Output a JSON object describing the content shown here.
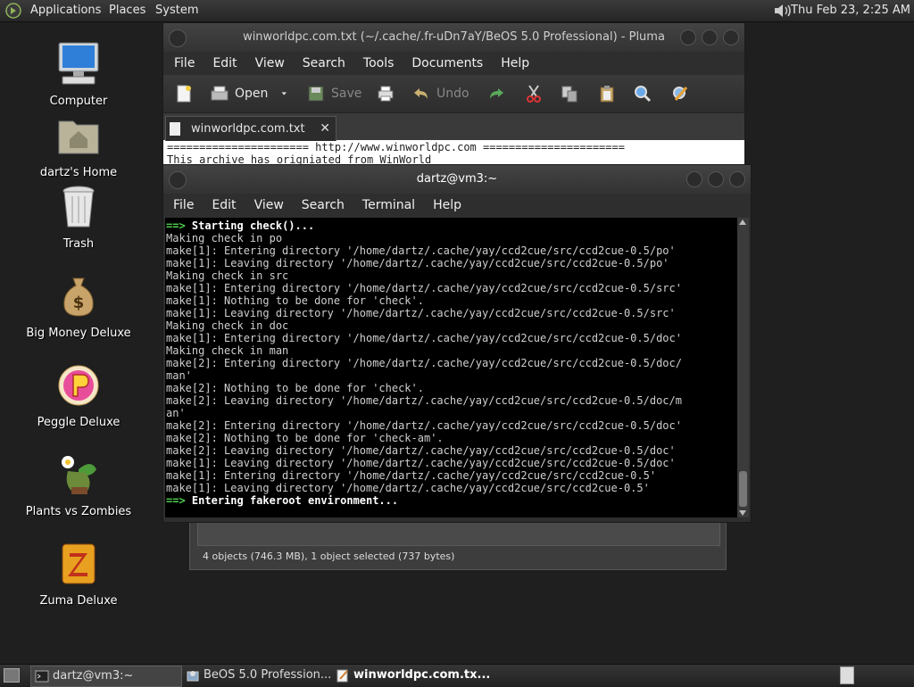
{
  "top_panel": {
    "menus": [
      "Applications",
      "Places",
      "System"
    ],
    "clock": "Thu Feb 23,  2:25 AM"
  },
  "desktop_icons": [
    {
      "label": "Computer",
      "icon": "computer-icon"
    },
    {
      "label": "dartz's Home",
      "icon": "home-folder-icon"
    },
    {
      "label": "Trash",
      "icon": "trash-icon"
    },
    {
      "label": "Big Money Deluxe",
      "icon": "money-bag-icon"
    },
    {
      "label": "Peggle Deluxe",
      "icon": "peggle-icon"
    },
    {
      "label": "Plants vs Zombies",
      "icon": "plants-zombies-icon"
    },
    {
      "label": "Zuma Deluxe",
      "icon": "zuma-icon"
    }
  ],
  "pluma": {
    "title": "winworldpc.com.txt (~/.cache/.fr-uDn7aY/BeOS 5.0 Professional) - Pluma",
    "menus": [
      "File",
      "Edit",
      "View",
      "Search",
      "Tools",
      "Documents",
      "Help"
    ],
    "toolbar": {
      "open": "Open",
      "save": "Save",
      "undo": "Undo"
    },
    "tab_name": "winworldpc.com.txt",
    "text_lines": [
      "====================== http://www.winworldpc.com ======================",
      "This archive has origniated from WinWorld"
    ]
  },
  "terminal": {
    "title": "dartz@vm3:~",
    "menus": [
      "File",
      "Edit",
      "View",
      "Search",
      "Terminal",
      "Help"
    ],
    "first_line": {
      "arrow": "==>",
      "text": "Starting check()..."
    },
    "lines": [
      "Making check in po",
      "make[1]: Entering directory '/home/dartz/.cache/yay/ccd2cue/src/ccd2cue-0.5/po'",
      "make[1]: Leaving directory '/home/dartz/.cache/yay/ccd2cue/src/ccd2cue-0.5/po'",
      "Making check in src",
      "make[1]: Entering directory '/home/dartz/.cache/yay/ccd2cue/src/ccd2cue-0.5/src'",
      "make[1]: Nothing to be done for 'check'.",
      "make[1]: Leaving directory '/home/dartz/.cache/yay/ccd2cue/src/ccd2cue-0.5/src'",
      "Making check in doc",
      "make[1]: Entering directory '/home/dartz/.cache/yay/ccd2cue/src/ccd2cue-0.5/doc'",
      "Making check in man",
      "make[2]: Entering directory '/home/dartz/.cache/yay/ccd2cue/src/ccd2cue-0.5/doc/",
      "man'",
      "make[2]: Nothing to be done for 'check'.",
      "make[2]: Leaving directory '/home/dartz/.cache/yay/ccd2cue/src/ccd2cue-0.5/doc/m",
      "an'",
      "make[2]: Entering directory '/home/dartz/.cache/yay/ccd2cue/src/ccd2cue-0.5/doc'",
      "make[2]: Nothing to be done for 'check-am'.",
      "make[2]: Leaving directory '/home/dartz/.cache/yay/ccd2cue/src/ccd2cue-0.5/doc'",
      "make[1]: Leaving directory '/home/dartz/.cache/yay/ccd2cue/src/ccd2cue-0.5/doc'",
      "make[1]: Entering directory '/home/dartz/.cache/yay/ccd2cue/src/ccd2cue-0.5'",
      "make[1]: Leaving directory '/home/dartz/.cache/yay/ccd2cue/src/ccd2cue-0.5'"
    ],
    "last_line": {
      "arrow": "==>",
      "text": "Entering fakeroot environment..."
    }
  },
  "file_manager": {
    "status": "4 objects (746.3 MB), 1 object selected (737 bytes)"
  },
  "taskbar": {
    "tasks": [
      {
        "label": "dartz@vm3:~"
      },
      {
        "label": "BeOS 5.0 Profession..."
      },
      {
        "label": "winworldpc.com.tx..."
      }
    ]
  },
  "colors": {
    "terminal_bg": "#000000",
    "terminal_prompt_arrow": "#4fd14f",
    "panel_bg": "#2a2a2a",
    "desktop_bg": "#1e1f1e"
  }
}
